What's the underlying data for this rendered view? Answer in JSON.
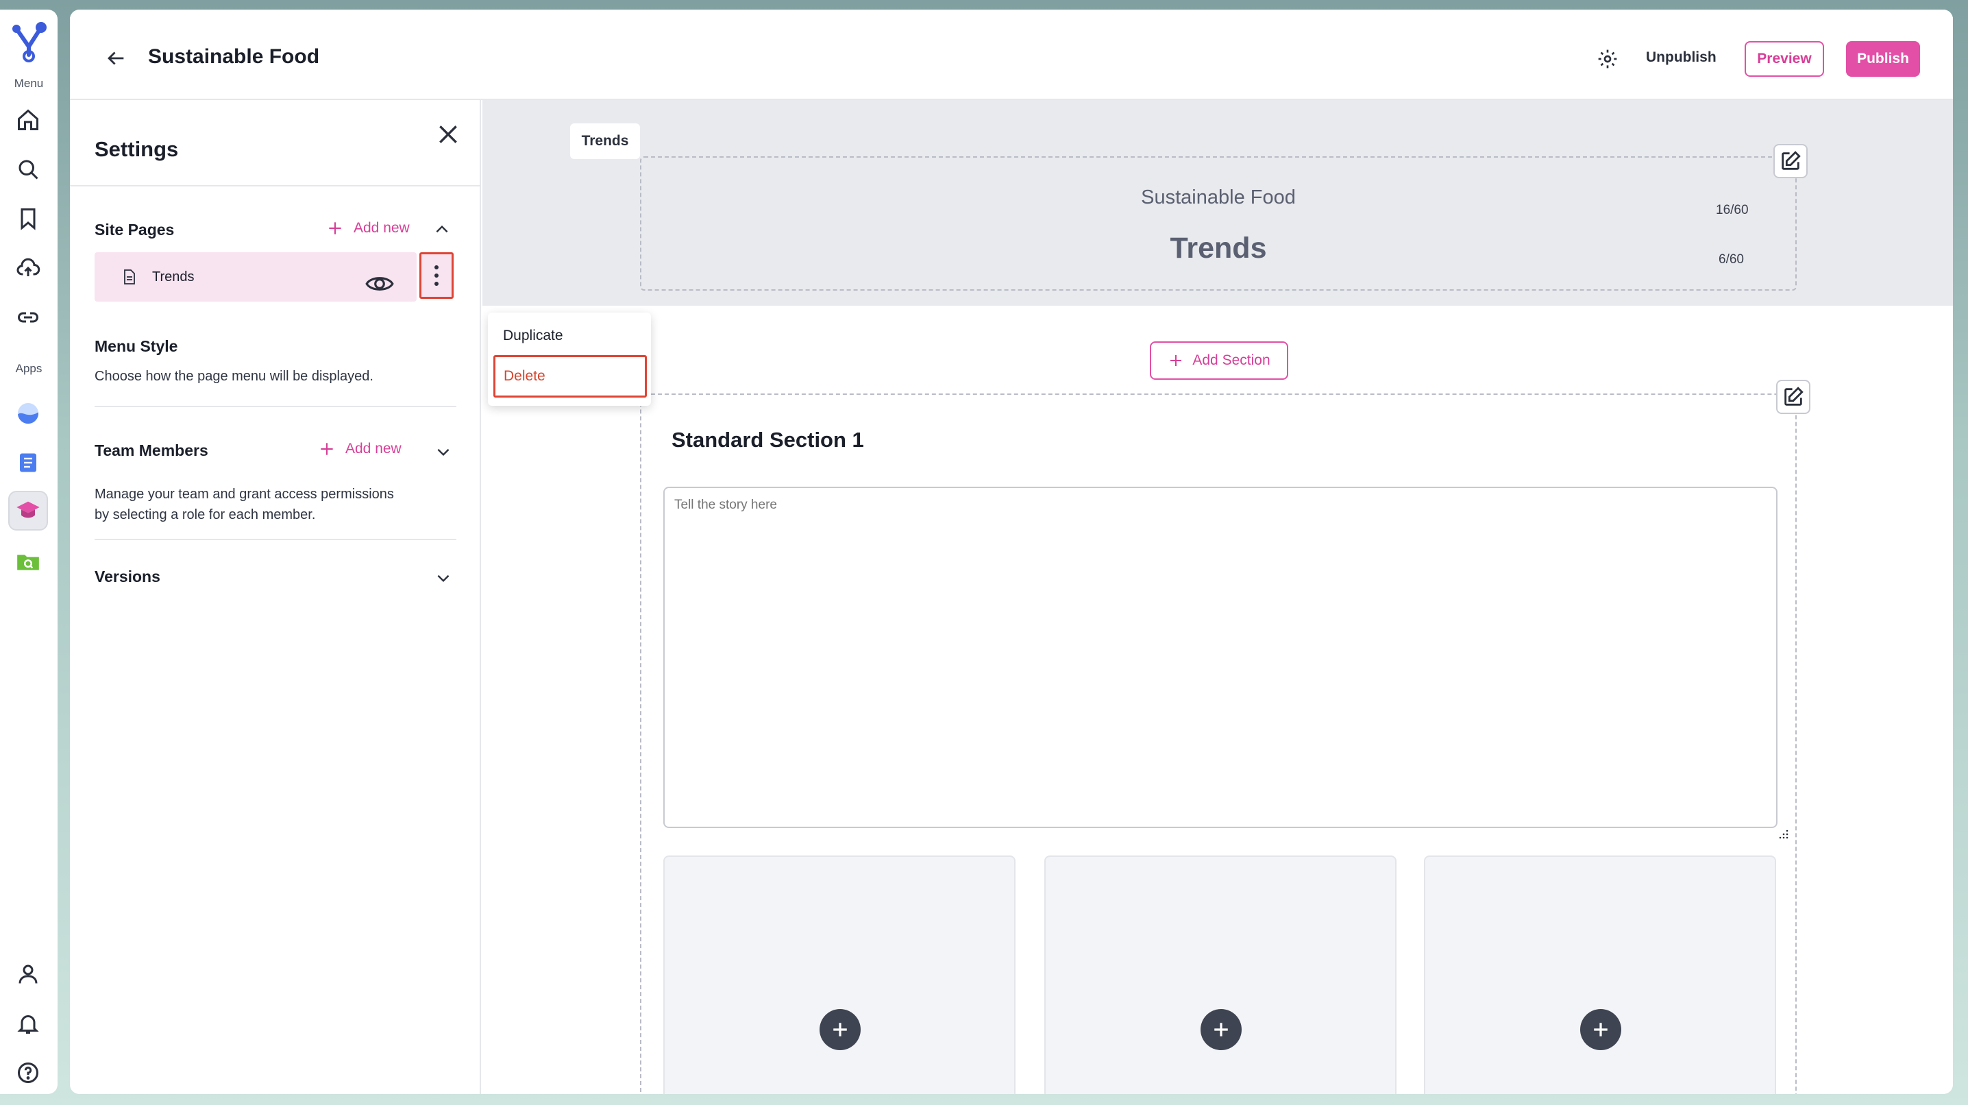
{
  "rail": {
    "logo": "logo-icon",
    "menu_label": "Menu",
    "apps_label": "Apps",
    "menu_items": [
      "home-icon",
      "search-icon",
      "bookmark-icon",
      "upload-cloud-icon",
      "link-icon"
    ],
    "app_items": [
      "wave-app-icon",
      "notes-app-icon",
      "course-app-icon",
      "folder-search-app-icon"
    ],
    "bottom_items": [
      "user-icon",
      "bell-icon",
      "help-icon"
    ]
  },
  "topbar": {
    "title": "Sustainable Food",
    "unpublish_label": "Unpublish",
    "preview_label": "Preview",
    "publish_label": "Publish"
  },
  "settings": {
    "title": "Settings",
    "site_pages": {
      "title": "Site Pages",
      "add_new": "Add new",
      "pages": [
        {
          "label": "Trends"
        }
      ]
    },
    "menu_style": {
      "title": "Menu Style",
      "description": "Choose how the page menu will be displayed."
    },
    "team_members": {
      "title": "Team Members",
      "add_new": "Add new",
      "description_line1": "Manage your team and grant access permissions",
      "description_line2": "by selecting a role for each member."
    },
    "versions": {
      "title": "Versions"
    }
  },
  "context_menu": {
    "duplicate": "Duplicate",
    "delete": "Delete"
  },
  "canvas": {
    "tab": "Trends",
    "hero": {
      "subtitle": "Sustainable Food",
      "title": "Trends",
      "subtitle_count": "16/60",
      "title_count": "6/60"
    },
    "add_section_label": "Add Section",
    "section": {
      "title": "Standard Section 1",
      "story_placeholder": "Tell the story here"
    }
  },
  "colors": {
    "accent": "#e34fa6",
    "highlight": "#e04433",
    "selected_row": "#f8e3f0"
  }
}
